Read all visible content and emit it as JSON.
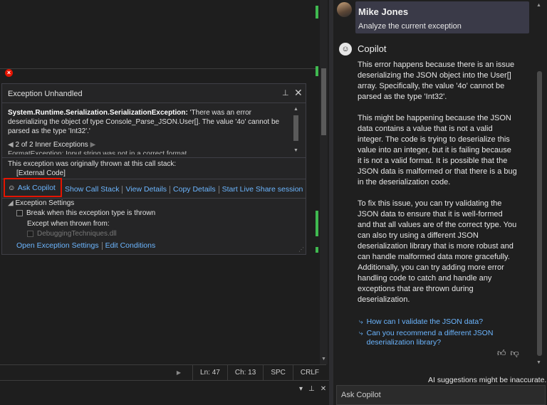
{
  "exception": {
    "title": "Exception Unhandled",
    "exception_type": "System.Runtime.Serialization.SerializationException:",
    "message": " 'There was an error deserializing the object of type Console_Parse_JSON.User[]. The value '4o' cannot be parsed as the type 'Int32'.'",
    "inner_exceptions": "2 of 2 Inner Exceptions",
    "inner_cutoff": "FormatException: Input string was not in a correct format",
    "thrown_label": "This exception was originally thrown at this call stack:",
    "external_code": "[External Code]",
    "links": {
      "ask_copilot": "Ask Copilot",
      "show_call_stack": "Show Call Stack",
      "view_details": "View Details",
      "copy_details": "Copy Details",
      "live_share": "Start Live Share session"
    },
    "settings": {
      "header": "Exception Settings",
      "break_when": "Break when this exception type is thrown",
      "except_from": "Except when thrown from:",
      "dll": "DebuggingTechniques.dll",
      "open_settings": "Open Exception Settings",
      "edit_conditions": "Edit Conditions"
    }
  },
  "status": {
    "ln": "Ln: 47",
    "ch": "Ch: 13",
    "spc": "SPC",
    "crlf": "CRLF"
  },
  "copilot": {
    "user_name": "Mike Jones",
    "user_message": "Analyze the current exception",
    "assistant_name": "Copilot",
    "paragraphs": [
      "This error happens because there is an issue deserializing the JSON object into the User[] array. Specifically, the value '4o' cannot be parsed as the type 'Int32'.",
      "This might be happening because the JSON data contains a value that is not a valid integer. The code is trying to deserialize this value into an integer, but it is failing because it is not a valid format. It is possible that the JSON data is malformed or that there is a bug in the deserialization code.",
      "To fix this issue, you can try validating the JSON data to ensure that it is well-formed and that all values are of the correct type. You can also try using a different JSON deserialization library that is more robust and can handle malformed data more gracefully. Additionally, you can try adding more error handling code to catch and handle any exceptions that are thrown during deserialization."
    ],
    "suggestions": [
      "How can I validate the JSON data?",
      "Can you recommend a different JSON deserialization library?"
    ],
    "warning": "AI suggestions might be inaccurate.",
    "input_placeholder": "Ask Copilot"
  }
}
